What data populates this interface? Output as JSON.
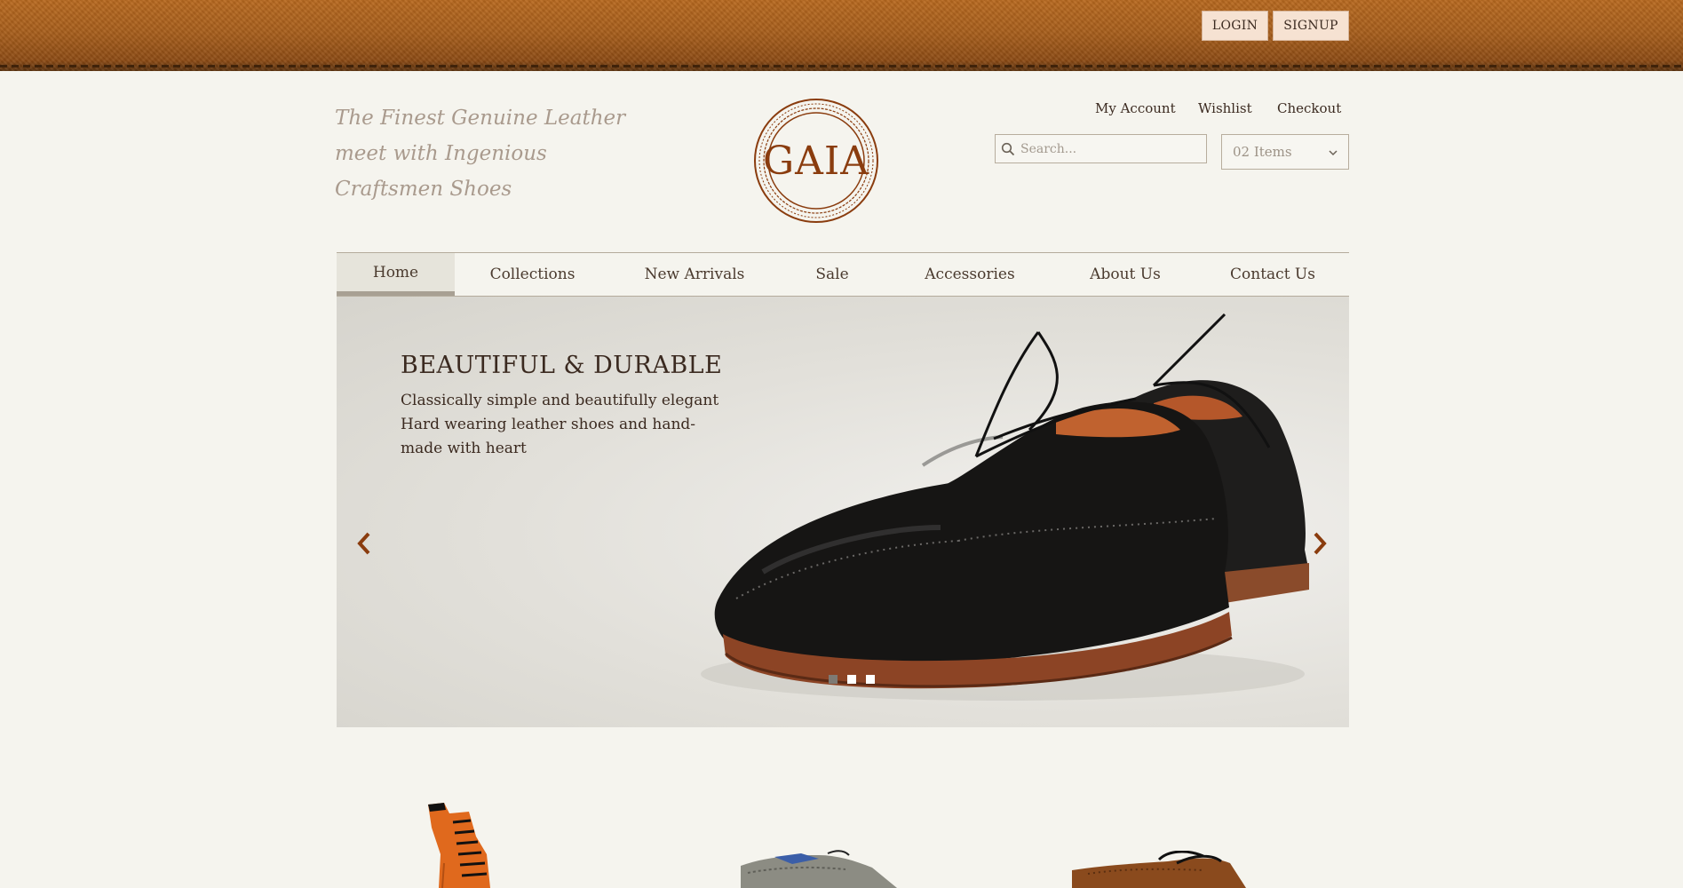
{
  "topbar": {
    "login_label": "LOGIN",
    "signup_label": "SIGNUP"
  },
  "header": {
    "tagline": "The Finest Genuine Leather meet with Ingenious Craftsmen Shoes",
    "logo_text": "GAIA",
    "account_links": {
      "my_account": "My Account",
      "wishlist": "Wishlist",
      "checkout": "Checkout"
    },
    "search": {
      "placeholder": "Search..."
    },
    "cart": {
      "selected": "02 Items"
    }
  },
  "nav": {
    "items": [
      {
        "label": "Home",
        "active": true
      },
      {
        "label": "Collections"
      },
      {
        "label": "New Arrivals"
      },
      {
        "label": "Sale"
      },
      {
        "label": "Accessories"
      },
      {
        "label": "About Us"
      },
      {
        "label": "Contact Us"
      }
    ]
  },
  "slider": {
    "title": "BEAUTIFUL & DURABLE",
    "text": "Classically simple and beautifully elegant Hard wearing leather shoes and hand-made with heart",
    "active_slide": 1,
    "slide_count": 3
  },
  "colors": {
    "accent_brown": "#8a3c0e",
    "leather_orange": "#a85f1c",
    "page_background": "#f5f4ee"
  }
}
